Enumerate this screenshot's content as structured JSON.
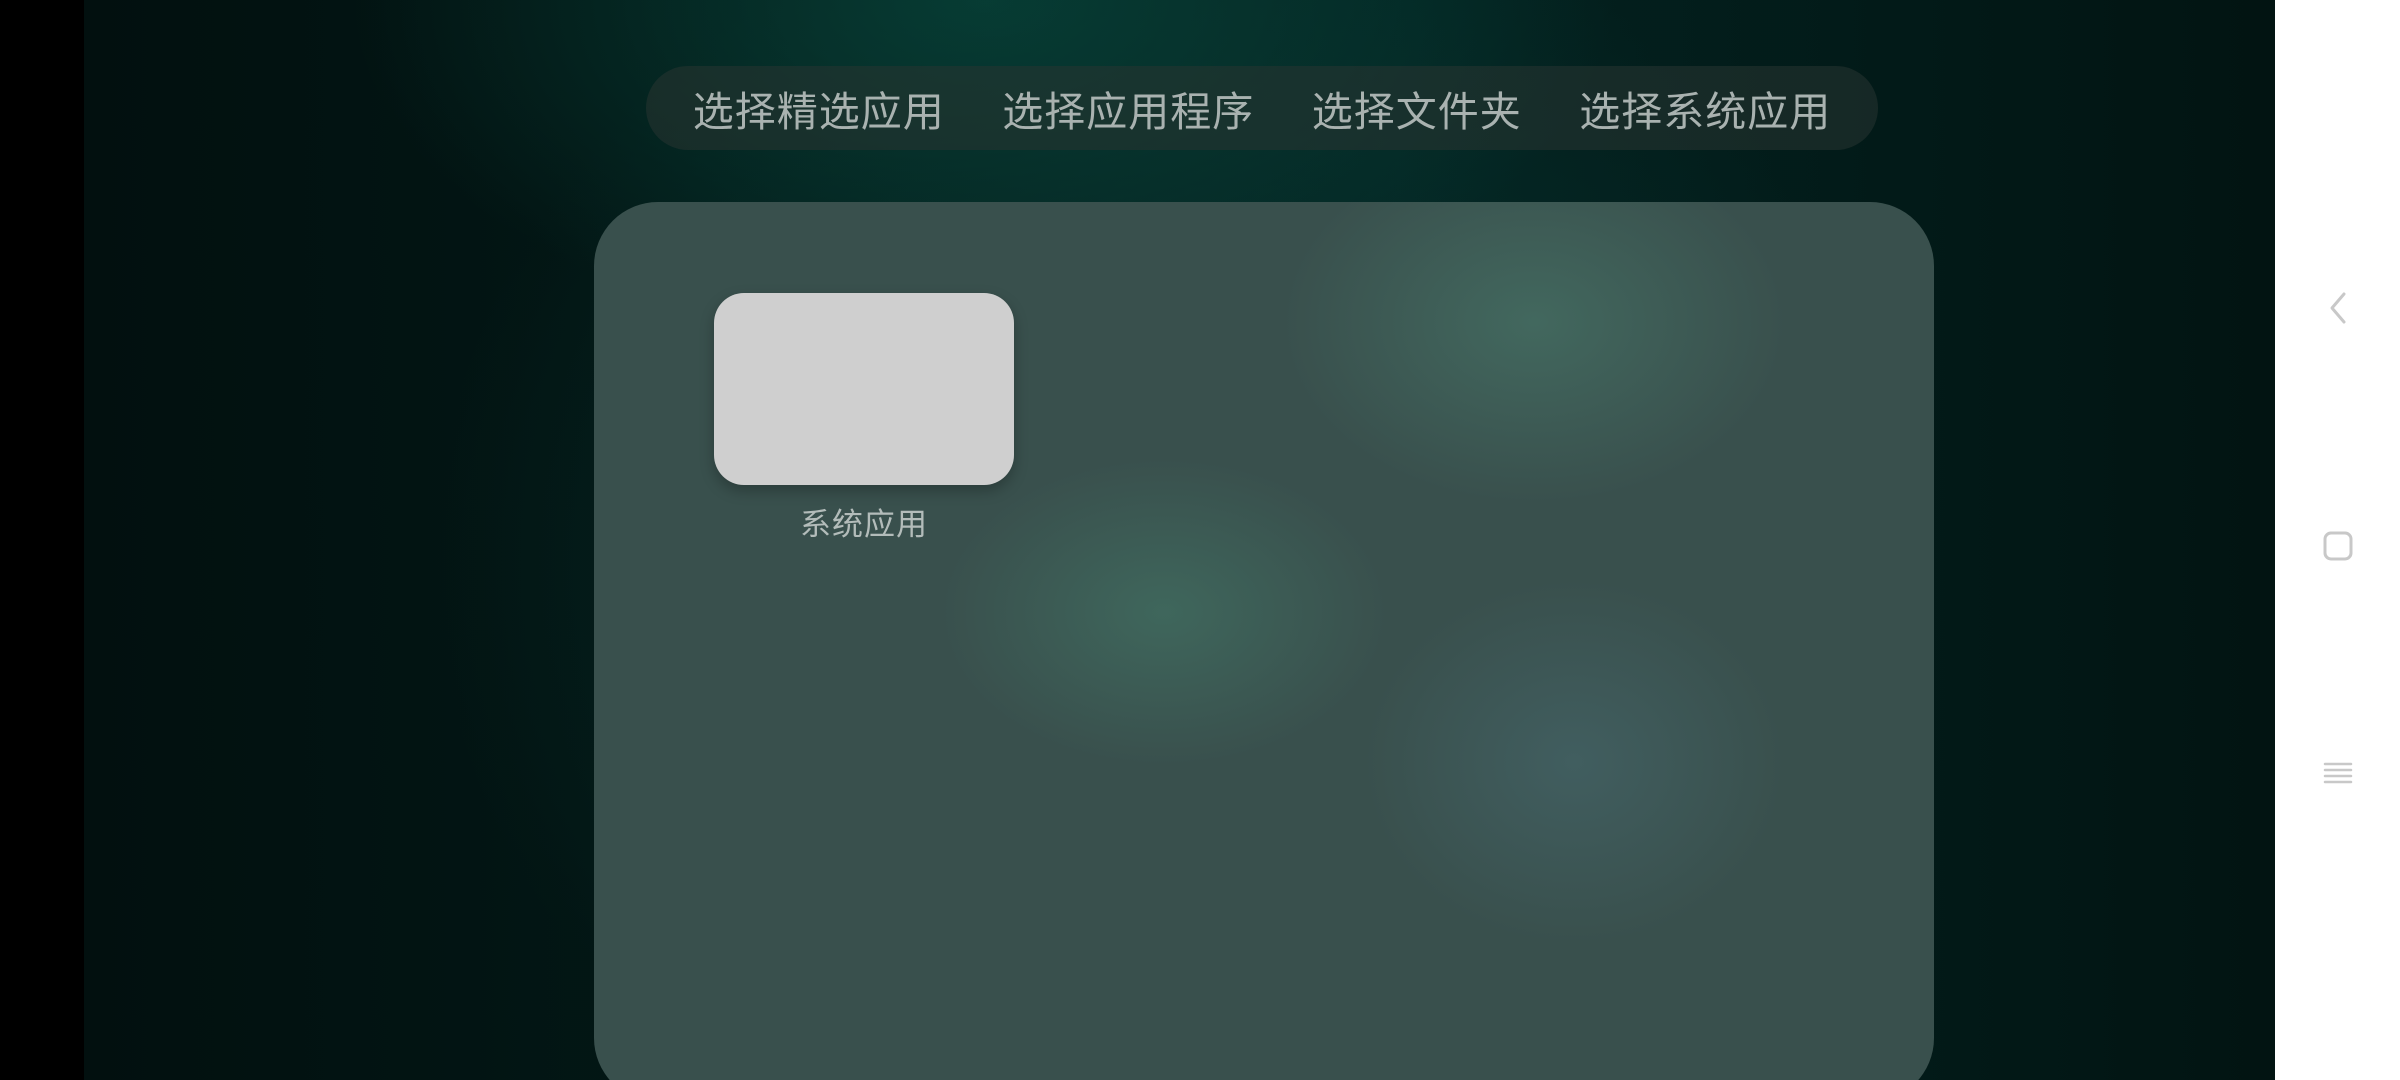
{
  "tabs": [
    {
      "label": "选择精选应用"
    },
    {
      "label": "选择应用程序"
    },
    {
      "label": "选择文件夹"
    },
    {
      "label": "选择系统应用"
    }
  ],
  "panel": {
    "apps": [
      {
        "label": "系统应用",
        "icon": "blank-folder-icon"
      }
    ]
  },
  "nav_bar": {
    "buttons": [
      "back-icon",
      "home-square-icon",
      "menu-lines-icon"
    ]
  },
  "colors": {
    "background_dark": "#031a18",
    "panel": "#39504d",
    "tab_text": "#a9b2b0",
    "app_icon": "#cfcfcf",
    "nav_bar": "#ffffff",
    "nav_icon": "#c8c8c8"
  }
}
